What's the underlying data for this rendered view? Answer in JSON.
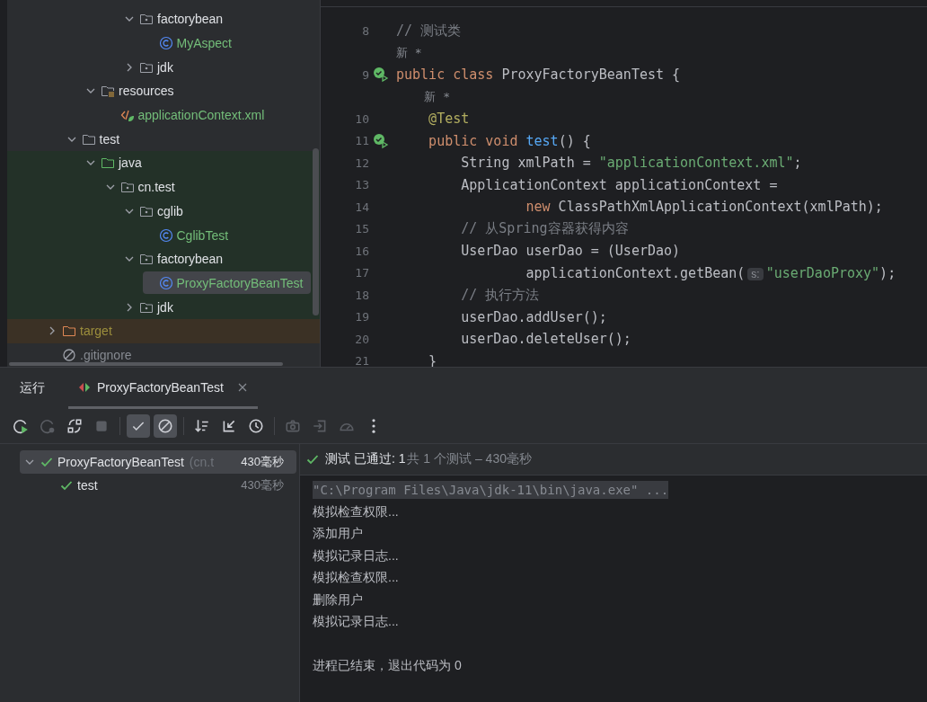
{
  "project_tree": [
    {
      "children": [
        {
          "children": [
            {
              "children": [
                {
                  "children": [
                    {
                      "label": "factorybean",
                      "kind": "package",
                      "expanded": true,
                      "selected": false,
                      "children": [
                        {
                          "label": "MyAspect",
                          "kind": "class",
                          "selected": false
                        }
                      ]
                    },
                    {
                      "label": "jdk",
                      "kind": "package",
                      "expanded": false,
                      "selected": false
                    }
                  ]
                }
              ]
            },
            {
              "label": "resources",
              "kind": "resources",
              "expanded": true,
              "selected": false,
              "children": [
                {
                  "label": "applicationContext.xml",
                  "kind": "xml",
                  "selected": false
                }
              ]
            }
          ]
        },
        {
          "label": "test",
          "kind": "folder",
          "expanded": true,
          "selected": false,
          "children": [
            {
              "label": "java",
              "kind": "test-root",
              "expanded": true,
              "selected": false,
              "children": [
                {
                  "label": "cn.test",
                  "kind": "package",
                  "expanded": true,
                  "selected": false,
                  "children": [
                    {
                      "label": "cglib",
                      "kind": "package",
                      "expanded": true,
                      "selected": false,
                      "children": [
                        {
                          "label": "CglibTest",
                          "kind": "class",
                          "selected": false
                        }
                      ]
                    },
                    {
                      "label": "factorybean",
                      "kind": "package",
                      "expanded": true,
                      "selected": false,
                      "children": [
                        {
                          "label": "ProxyFactoryBeanTest",
                          "kind": "class",
                          "selected": true
                        }
                      ]
                    },
                    {
                      "label": "jdk",
                      "kind": "package",
                      "expanded": false,
                      "selected": false
                    }
                  ]
                }
              ]
            }
          ]
        }
      ]
    },
    {
      "label": "target",
      "kind": "excluded",
      "expanded": false,
      "selected": false
    },
    {
      "label": ".gitignore",
      "kind": "ignored",
      "selected": false
    }
  ],
  "editor_lines": [
    {
      "number": "8",
      "run_marker": false,
      "segments": [
        {
          "kind": "comment",
          "text": "// 测试类"
        }
      ]
    },
    {
      "kind": "hint",
      "text": "新 *"
    },
    {
      "number": "9",
      "run_marker": true,
      "segments": [
        {
          "kind": "keyword",
          "text": "public class "
        },
        {
          "kind": "plain",
          "text": "ProxyFactoryBeanTest {"
        }
      ]
    },
    {
      "kind": "hint",
      "text": "    新 *"
    },
    {
      "number": "10",
      "run_marker": false,
      "segments": [
        {
          "kind": "annotation",
          "text": "    @Test"
        }
      ]
    },
    {
      "number": "11",
      "run_marker": true,
      "segments": [
        {
          "kind": "keyword",
          "text": "    public void "
        },
        {
          "kind": "method",
          "text": "test"
        },
        {
          "kind": "plain",
          "text": "() {"
        }
      ]
    },
    {
      "number": "12",
      "run_marker": false,
      "segments": [
        {
          "kind": "plain",
          "text": "        String xmlPath = "
        },
        {
          "kind": "string",
          "text": "\"applicationContext.xml\""
        },
        {
          "kind": "plain",
          "text": ";"
        }
      ]
    },
    {
      "number": "13",
      "run_marker": false,
      "segments": [
        {
          "kind": "plain",
          "text": "        ApplicationContext applicationContext ="
        }
      ]
    },
    {
      "number": "14",
      "run_marker": false,
      "segments": [
        {
          "kind": "keyword",
          "text": "                new"
        },
        {
          "kind": "plain",
          "text": " ClassPathXmlApplicationContext(xmlPath);"
        }
      ]
    },
    {
      "number": "15",
      "run_marker": false,
      "segments": [
        {
          "kind": "comment",
          "text": "        // 从Spring容器获得内容"
        }
      ]
    },
    {
      "number": "16",
      "run_marker": false,
      "segments": [
        {
          "kind": "plain",
          "text": "        UserDao userDao = (UserDao)"
        }
      ]
    },
    {
      "number": "17",
      "run_marker": false,
      "segments": [
        {
          "kind": "plain",
          "text": "                applicationContext.getBean("
        },
        {
          "kind": "param",
          "text": "s:"
        },
        {
          "kind": "string",
          "text": "\"userDaoProxy\""
        },
        {
          "kind": "plain",
          "text": ");"
        }
      ]
    },
    {
      "number": "18",
      "run_marker": false,
      "segments": [
        {
          "kind": "comment",
          "text": "        // 执行方法"
        }
      ]
    },
    {
      "number": "19",
      "run_marker": false,
      "segments": [
        {
          "kind": "plain",
          "text": "        userDao.addUser();"
        }
      ]
    },
    {
      "number": "20",
      "run_marker": false,
      "segments": [
        {
          "kind": "plain",
          "text": "        userDao.deleteUser();"
        }
      ]
    },
    {
      "number": "21",
      "run_marker": false,
      "segments": [
        {
          "kind": "plain",
          "text": "    }"
        }
      ]
    }
  ],
  "run_panel": {
    "title": "运行",
    "tabs": [
      {
        "label": "ProxyFactoryBeanTest",
        "selected": true
      }
    ],
    "toolbar": [
      {
        "kind": "rerun",
        "disabled": false,
        "on": false
      },
      {
        "kind": "rerun-failed",
        "disabled": true,
        "on": false
      },
      {
        "kind": "toggle-auto",
        "disabled": false,
        "on": false
      },
      {
        "kind": "stop",
        "disabled": true,
        "on": false
      },
      {
        "kind": "sep"
      },
      {
        "kind": "show-passed",
        "disabled": false,
        "on": true
      },
      {
        "kind": "show-ignored",
        "disabled": false,
        "on": true
      },
      {
        "kind": "sep"
      },
      {
        "kind": "sort",
        "disabled": false,
        "on": false
      },
      {
        "kind": "collapse",
        "disabled": false,
        "on": false
      },
      {
        "kind": "history",
        "disabled": false,
        "on": false
      },
      {
        "kind": "sep"
      },
      {
        "kind": "camera",
        "disabled": true,
        "on": false
      },
      {
        "kind": "import",
        "disabled": true,
        "on": false
      },
      {
        "kind": "gauge",
        "disabled": true,
        "on": false
      },
      {
        "kind": "more",
        "disabled": false,
        "on": false
      }
    ],
    "tests": [
      {
        "name": "ProxyFactoryBeanTest",
        "location": "(cn.t",
        "time": "430毫秒",
        "selected": true,
        "expanded": true,
        "children": [
          {
            "name": "test",
            "time": "430毫秒",
            "selected": false
          }
        ]
      }
    ],
    "status": {
      "passed": "测试 已通过: 1",
      "summary": "共 1 个测试 – 430毫秒"
    },
    "console": [
      {
        "kind": "command",
        "text": "\"C:\\Program Files\\Java\\jdk-11\\bin\\java.exe\" ..."
      },
      {
        "kind": "output",
        "text": "模拟检查权限..."
      },
      {
        "kind": "output",
        "text": "添加用户"
      },
      {
        "kind": "output",
        "text": "模拟记录日志..."
      },
      {
        "kind": "output",
        "text": "模拟检查权限..."
      },
      {
        "kind": "output",
        "text": "删除用户"
      },
      {
        "kind": "output",
        "text": "模拟记录日志..."
      },
      {
        "kind": "exit",
        "text": "进程已结束，退出代码为 0"
      }
    ]
  }
}
